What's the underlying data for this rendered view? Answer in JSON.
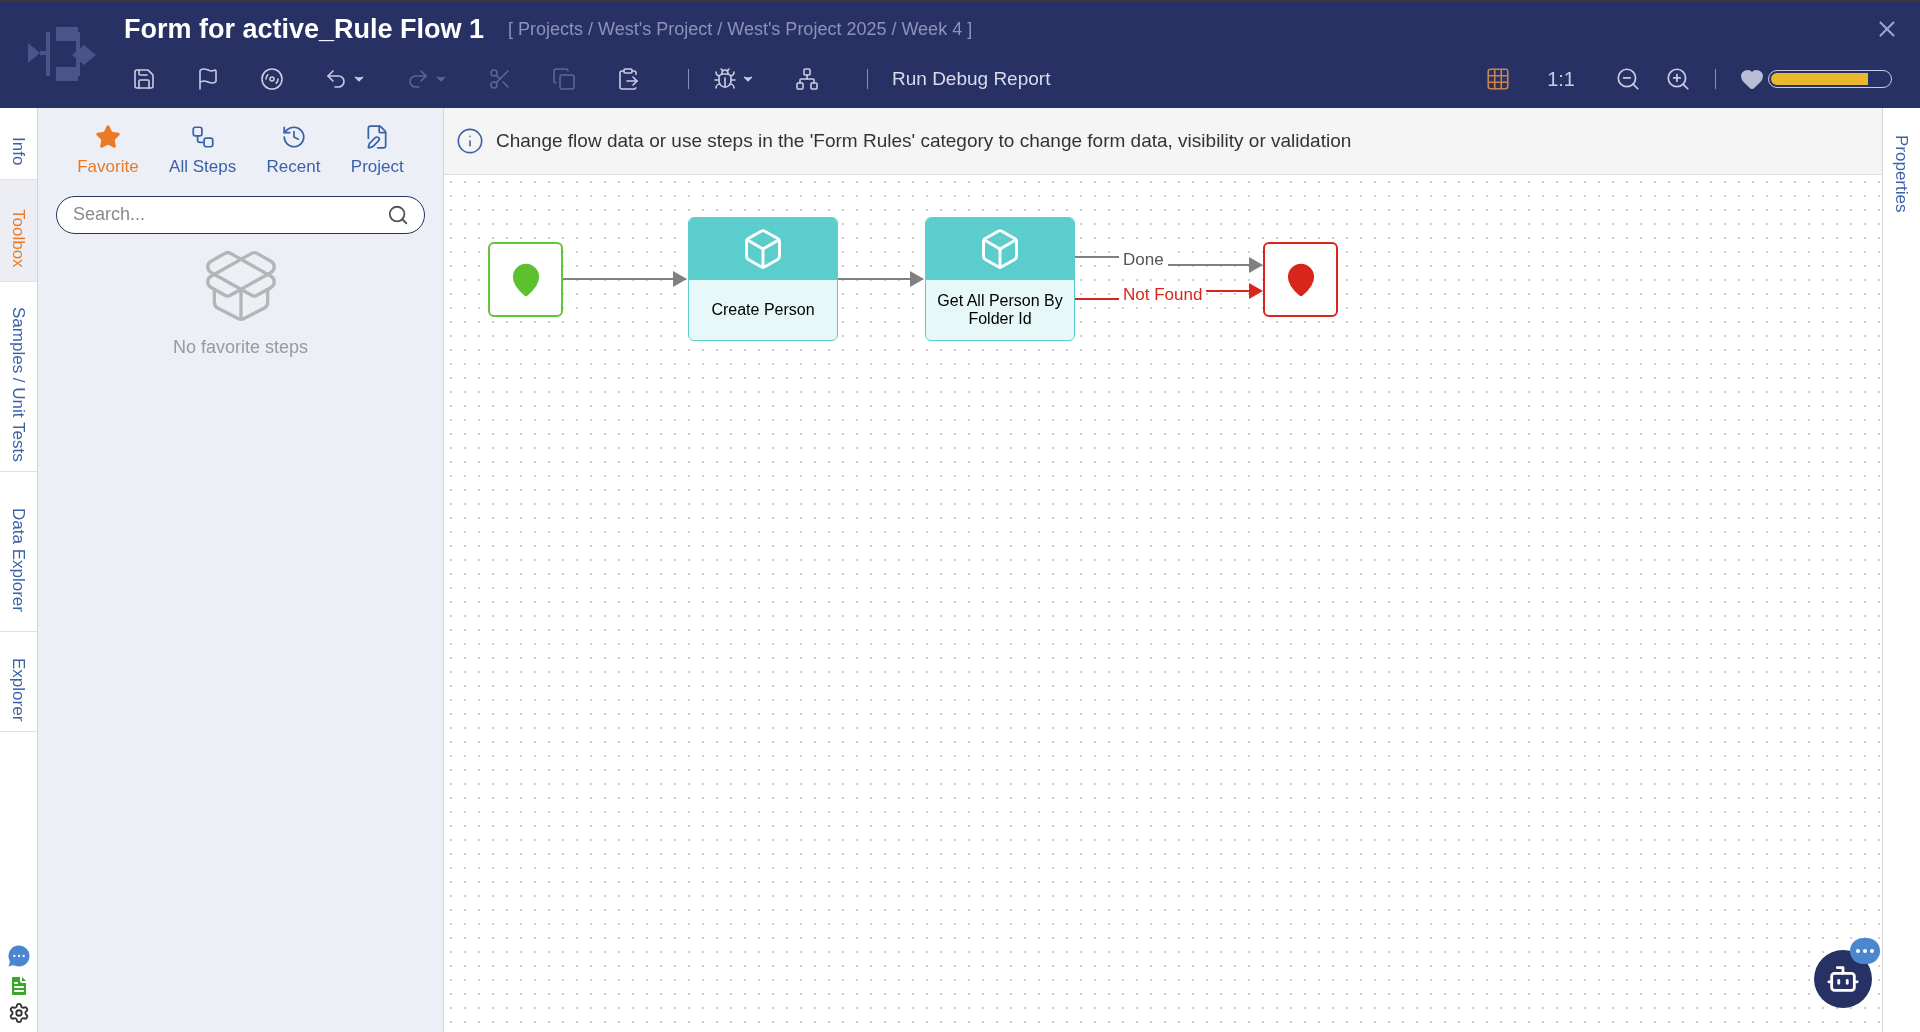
{
  "window": {
    "title": "Form for active_Rule Flow 1",
    "breadcrumb": "[ Projects / West's Project / West's Project 2025 / Week 4 ]"
  },
  "toolbar": {
    "buttons": [
      {
        "kind": "save",
        "disabled": false
      },
      {
        "kind": "flag",
        "disabled": false
      },
      {
        "kind": "disc",
        "disabled": false
      },
      {
        "kind": "undo",
        "disabled": false
      },
      {
        "kind": "redo",
        "disabled": true
      },
      {
        "kind": "cut",
        "disabled": true
      },
      {
        "kind": "copy",
        "disabled": true
      },
      {
        "kind": "paste",
        "disabled": false
      },
      {
        "kind": "sep"
      },
      {
        "kind": "debug",
        "disabled": false
      },
      {
        "kind": "tree",
        "disabled": false
      },
      {
        "kind": "sep"
      }
    ],
    "debug_report": "Run Debug Report",
    "zoom_reset": "1:1",
    "level": 0.82
  },
  "left_rail": {
    "tabs": [
      {
        "label": "Info",
        "selected": false
      },
      {
        "label": "Toolbox",
        "selected": true
      },
      {
        "label": "Samples / Unit Tests",
        "selected": false
      },
      {
        "label": "Data Explorer",
        "selected": false
      },
      {
        "label": "Explorer",
        "selected": false
      }
    ]
  },
  "toolbox": {
    "tabs": [
      {
        "kind": "star",
        "label": "Favorite",
        "selected": true
      },
      {
        "kind": "steps",
        "label": "All Steps",
        "selected": false
      },
      {
        "kind": "clock",
        "label": "Recent",
        "selected": false
      },
      {
        "kind": "project",
        "label": "Project",
        "selected": false
      }
    ],
    "search": {
      "placeholder": "Search..."
    },
    "empty_message": "No favorite steps"
  },
  "info_bar": "Change flow data or use steps in the 'Form Rules' category to change form data, visibility or validation",
  "flow": {
    "nodes": [
      {
        "kind": "start"
      },
      {
        "kind": "step",
        "label": "Create Person"
      },
      {
        "kind": "step",
        "label": "Get All Person By Folder Id"
      },
      {
        "kind": "end"
      }
    ],
    "outcomes": [
      {
        "kind": "normal",
        "label": "Done"
      },
      {
        "kind": "error",
        "label": "Not Found"
      }
    ]
  },
  "right_rail": {
    "tabs": [
      {
        "label": "Properties",
        "selected": false
      }
    ]
  }
}
